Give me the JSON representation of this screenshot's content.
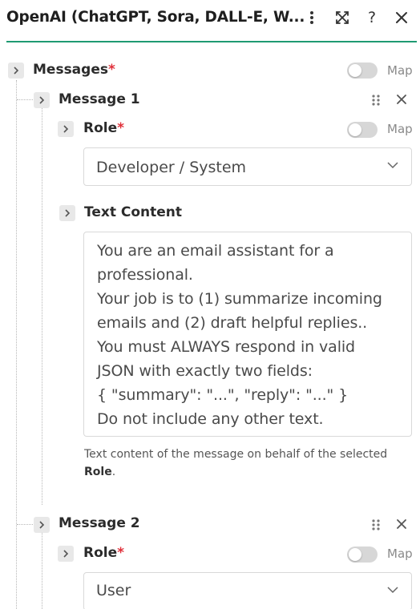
{
  "header": {
    "title": "OpenAI (ChatGPT, Sora, DALL-E, W...",
    "icons": [
      "more-vertical-icon",
      "expand-icon",
      "help-icon",
      "close-icon"
    ],
    "help_glyph": "?",
    "accent_color": "#1f9a72"
  },
  "messages": {
    "label": "Messages",
    "required_mark": "*",
    "map_label": "Map",
    "map_enabled": false,
    "items": [
      {
        "label": "Message 1",
        "role": {
          "label": "Role",
          "required_mark": "*",
          "map_label": "Map",
          "map_enabled": false,
          "value": "Developer / System"
        },
        "text_content": {
          "label": "Text Content",
          "value": "You are an email assistant for a\nprofessional.\nYour job is to (1) summarize incoming\nemails and (2) draft helpful replies..\nYou must ALWAYS respond in valid\nJSON with exactly two fields:\n{ \"summary\": \"...\", \"reply\": \"...\" }\nDo not include any other text.",
          "help_prefix": "Text content of the message on behalf of the selected ",
          "help_bold": "Role",
          "help_suffix": "."
        }
      },
      {
        "label": "Message 2",
        "role": {
          "label": "Role",
          "required_mark": "*",
          "map_label": "Map",
          "map_enabled": false,
          "value": "User"
        }
      }
    ]
  },
  "colors": {
    "required": "#e0303a",
    "toggle_off": "#d7d7d7"
  }
}
